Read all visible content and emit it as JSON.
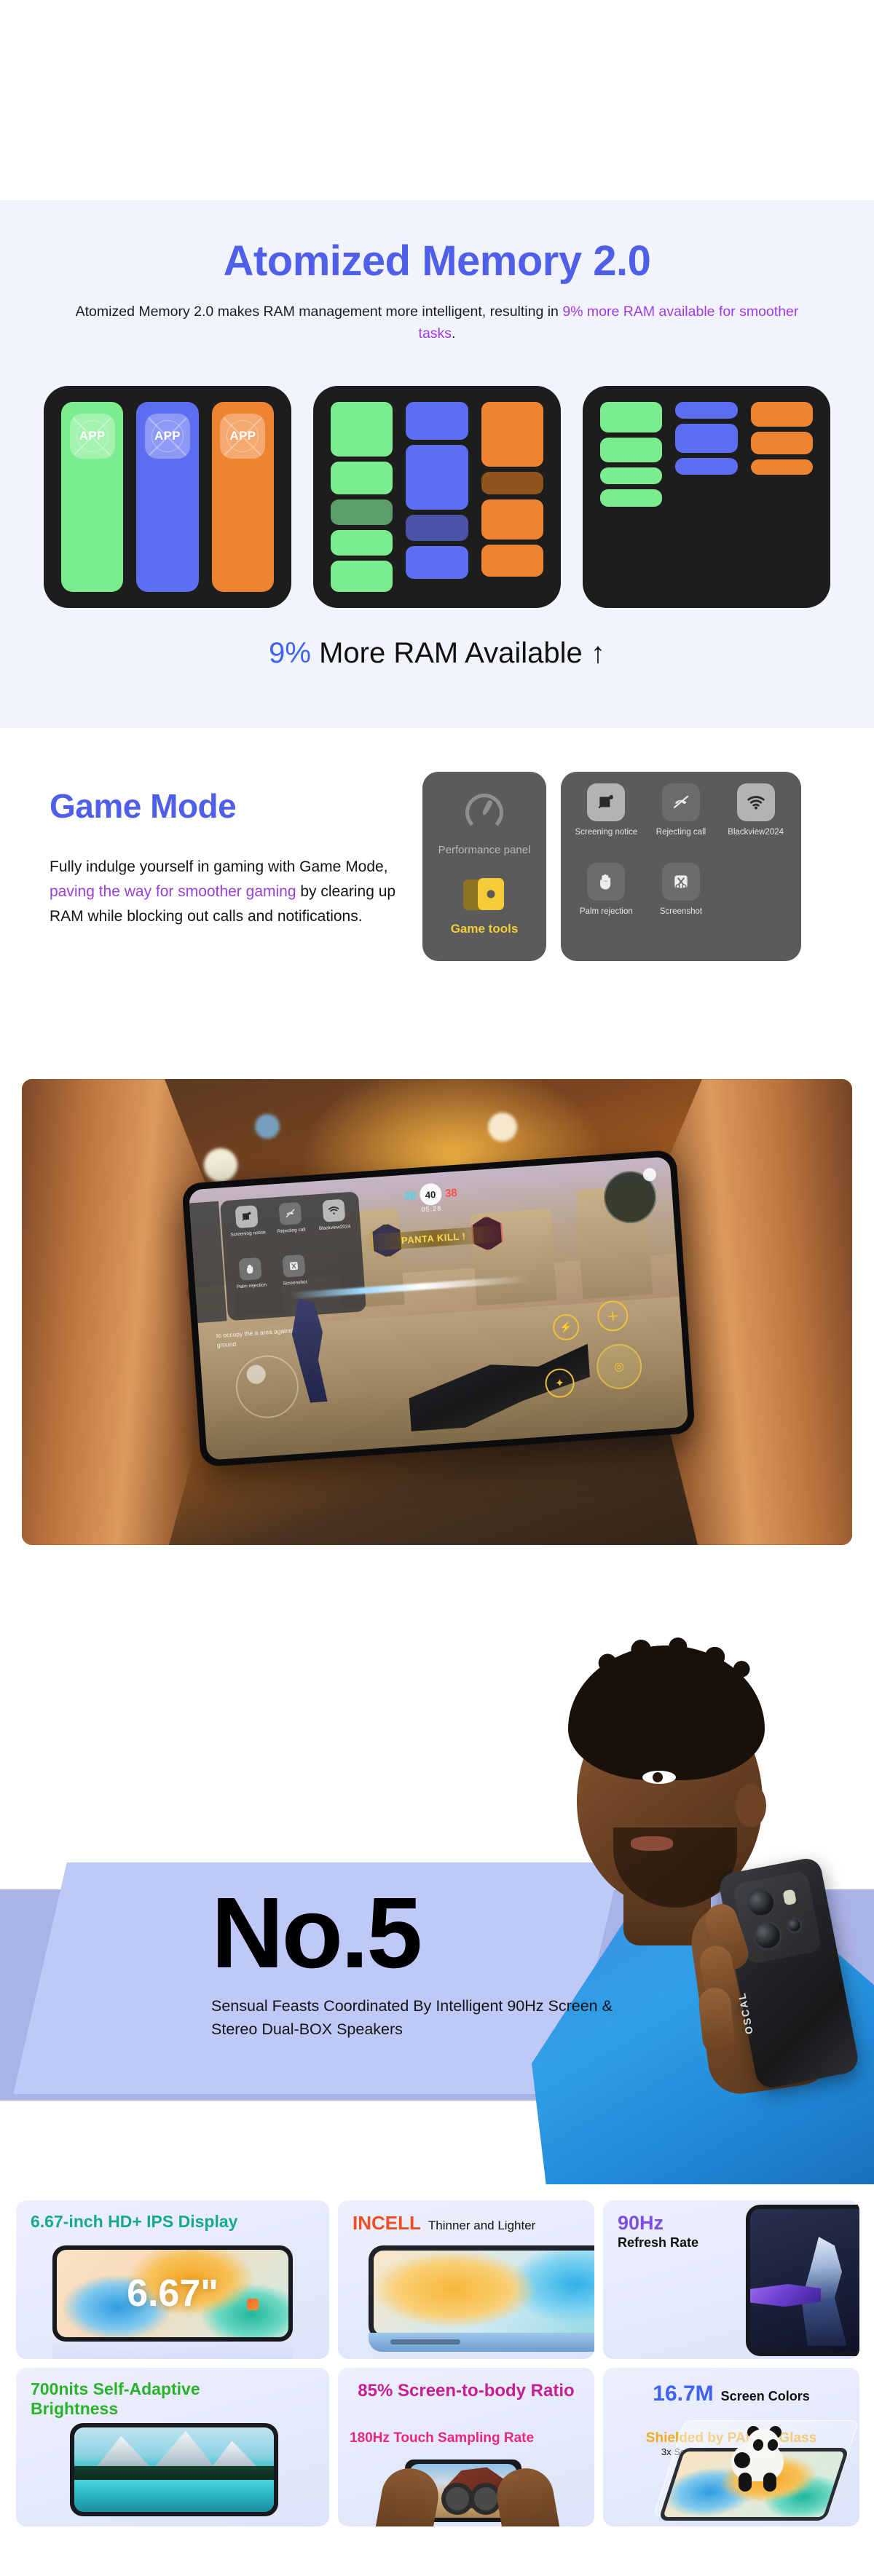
{
  "memory_section": {
    "title": "Atomized Memory 2.0",
    "subtitle_part1": "Atomized Memory 2.0 makes RAM management more intelligent, resulting in ",
    "subtitle_highlight": "9% more RAM available for smoother tasks",
    "subtitle_part2": ".",
    "footer_percent": "9%",
    "footer_text": " More RAM Available ↑",
    "app_label": "APP",
    "accent_color": "#4f5fe8",
    "highlight_color": "#a03bdd",
    "bg_color": "#f1f4fd",
    "cards": [
      {
        "name": "unified-memory-card",
        "layout": "full-bars",
        "columns": [
          {
            "color_key": "green",
            "blocks": [
              100
            ]
          },
          {
            "color_key": "blue",
            "blocks": [
              100
            ]
          },
          {
            "color_key": "orange",
            "blocks": [
              100
            ]
          }
        ]
      },
      {
        "name": "fragmented-memory-card",
        "layout": "fragments",
        "columns": [
          {
            "color_key": "green",
            "blocks": [
              30,
              18,
              14,
              14,
              17
            ]
          },
          {
            "color_key": "blue",
            "blocks": [
              20,
              34,
              14,
              17
            ]
          },
          {
            "color_key": "orange",
            "blocks": [
              34,
              12,
              21,
              17
            ]
          }
        ]
      },
      {
        "name": "compact-memory-card",
        "layout": "compact",
        "columns": [
          {
            "color_key": "green",
            "blocks": [
              16,
              13,
              9,
              9
            ]
          },
          {
            "color_key": "blue",
            "blocks": [
              9,
              15,
              9
            ]
          },
          {
            "color_key": "orange",
            "blocks": [
              13,
              12,
              8
            ]
          }
        ]
      }
    ],
    "palette": {
      "green": "#7ced8f",
      "green_dim": "#5c9e67",
      "blue": "#5d6ef2",
      "blue_dim": "#4a53a8",
      "orange": "#ee8431",
      "orange_dim": "#90551f"
    }
  },
  "game_mode": {
    "title": "Game Mode",
    "body_part1": "Fully indulge yourself in gaming with Game Mode, ",
    "body_highlight": "paving the way for smoother gaming",
    "body_part2": " by clearing up RAM while blocking out calls and notifications.",
    "performance_panel_label": "Performance panel",
    "game_tools_label": "Game tools",
    "tools": [
      {
        "label": "Screening notice",
        "icon": "screen-off-icon",
        "active": true
      },
      {
        "label": "Rejecting call",
        "icon": "call-reject-icon",
        "active": false
      },
      {
        "label": "Blackview2024",
        "icon": "wifi-icon",
        "active": true
      },
      {
        "label": "Palm rejection",
        "icon": "palm-icon",
        "active": false
      },
      {
        "label": "Screenshot",
        "icon": "scissors-icon",
        "active": false
      }
    ]
  },
  "hero": {
    "kill_banner": "PANTA KILL !",
    "score_left": "39",
    "score_center": "40",
    "score_right": "38",
    "timer": "05:28",
    "hint": "to occupy the a area against the ground",
    "overlay_tools": [
      {
        "label": "Screening notice"
      },
      {
        "label": "Rejecting call"
      },
      {
        "label": "Blackview2024"
      },
      {
        "label": "Palm rejection"
      },
      {
        "label": "Screenshot"
      }
    ]
  },
  "no5": {
    "number": "No.5",
    "description": "Sensual Feasts Coordinated By Intelligent 90Hz Screen & Stereo Dual-BOX Speakers",
    "phone_brand": "OSCAL",
    "slab_front_color": "#bfc9f7",
    "slab_back_color": "#aab3e8"
  },
  "features": [
    {
      "name": "display-size-card",
      "title_main": "6.67-inch HD+ IPS Display",
      "title_color": "#17a98c",
      "screen_text": "6.67\"",
      "span": "tall"
    },
    {
      "name": "incell-card",
      "title_main": "INCELL",
      "title_main_color": "#f04e23",
      "title_sub": "Thinner and Lighter",
      "title_sub_color": "#111111"
    },
    {
      "name": "refresh-rate-card",
      "title_main": "90Hz",
      "title_main_color": "#7c4fe0",
      "title_sub": "Refresh Rate",
      "title_sub_color": "#111111"
    },
    {
      "name": "screen-body-ratio-card",
      "title_main": "85% Screen-to-body Ratio",
      "title_color": "#c61f91"
    },
    {
      "name": "screen-colors-card",
      "title_main": "16.7M",
      "title_main_color": "#3e63f0",
      "title_sub": "Screen Colors",
      "title_sub_color": "#111111"
    },
    {
      "name": "brightness-card",
      "title_main": "700nits Self-Adaptive Brightness",
      "title_color": "#2bb22b"
    },
    {
      "name": "touch-sampling-card",
      "title_main": "180Hz Touch Sampling Rate",
      "title_color": "#e8277f"
    },
    {
      "name": "panda-glass-card",
      "title_main": "Shielded by PANDA Glass",
      "title_main_color": "#f0ab24",
      "title_sub": "3x Scratch and Crack Resistance",
      "title_sub_color": "#111111"
    }
  ]
}
